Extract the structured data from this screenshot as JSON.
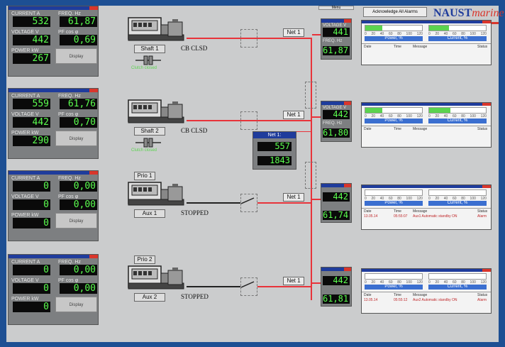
{
  "top_bar": {
    "menu_label": "Menu",
    "ack_button": "Acknowledge All Alarms",
    "brand_left": "NAUST",
    "brand_right": "marine"
  },
  "meter_panels": [
    {
      "current_label": "CURRENT A",
      "current": "532",
      "freq_label": "FREQ. Hz",
      "freq": "61,87",
      "voltage_label": "VOLTAGE V",
      "voltage": "442",
      "pf_label": "PF cos φ",
      "pf": "0,69",
      "power_label": "POWER kW",
      "power": "267",
      "display_label": "Display"
    },
    {
      "current_label": "CURRENT A",
      "current": "559",
      "freq_label": "FREQ. Hz",
      "freq": "61,76",
      "voltage_label": "VOLTAGE V",
      "voltage": "442",
      "pf_label": "PF cos φ",
      "pf": "0,70",
      "power_label": "POWER kW",
      "power": "290",
      "display_label": "Display"
    },
    {
      "current_label": "CURRENT A",
      "current": "0",
      "freq_label": "FREQ. Hz",
      "freq": "0,00",
      "voltage_label": "VOLTAGE V",
      "voltage": "0",
      "pf_label": "PF cos φ",
      "pf": "0,00",
      "power_label": "POWER kW",
      "power": "0",
      "display_label": "Display"
    },
    {
      "current_label": "CURRENT A",
      "current": "0",
      "freq_label": "FREQ. Hz",
      "freq": "0,00",
      "voltage_label": "VOLTAGE V",
      "voltage": "0",
      "pf_label": "PF cos φ",
      "pf": "0,00",
      "power_label": "POWER kW",
      "power": "0",
      "display_label": "Display"
    }
  ],
  "generators": [
    {
      "name": "Shaft 1",
      "prio": "",
      "status": "CB CLSD",
      "clutch": "Clutch closed",
      "breaker": "closed"
    },
    {
      "name": "Shaft 2",
      "prio": "",
      "status": "CB CLSD",
      "clutch": "Clutch closed",
      "breaker": "closed"
    },
    {
      "name": "Aux 1",
      "prio": "Prio 1",
      "status": "STOPPED",
      "clutch": "",
      "breaker": "open"
    },
    {
      "name": "Aux 2",
      "prio": "Prio 2",
      "status": "STOPPED",
      "clutch": "",
      "breaker": "open"
    }
  ],
  "net_labels": [
    "Net 1",
    "Net 1",
    "Net 1",
    "Net 1"
  ],
  "net_popup": {
    "title": "Net 1:",
    "value1": "557",
    "value2": "1843"
  },
  "right_meters": [
    {
      "voltage_label": "VOLTAGE V",
      "voltage": "441",
      "freq_label": "FREQ. Hz",
      "freq": "61,87"
    },
    {
      "voltage_label": "VOLTAGE V",
      "voltage": "442",
      "freq_label": "FREQ. Hz",
      "freq": "61,80"
    },
    {
      "voltage_label": "",
      "voltage": "442",
      "freq_label": "",
      "freq": "61,74"
    },
    {
      "voltage_label": "",
      "voltage": "442",
      "freq_label": "",
      "freq": "61,81"
    }
  ],
  "gauges": [
    {
      "power_title": "Power, %",
      "power_fill": 0.3,
      "current_title": "Current, %",
      "current_fill": 0.35,
      "log_header": {
        "date": "Date",
        "time": "Time",
        "message": "Message",
        "status": "Status"
      },
      "log": {
        "date": "",
        "time": "",
        "message": "",
        "status": ""
      }
    },
    {
      "power_title": "Power, %",
      "power_fill": 0.3,
      "current_title": "Current, %",
      "current_fill": 0.38,
      "log_header": {
        "date": "Date",
        "time": "Time",
        "message": "Message",
        "status": "Status"
      },
      "log": {
        "date": "",
        "time": "",
        "message": "",
        "status": ""
      }
    },
    {
      "power_title": "Power, %",
      "power_fill": 0,
      "current_title": "Current, %",
      "current_fill": 0,
      "log_header": {
        "date": "Date",
        "time": "Time",
        "message": "Message",
        "status": "Status"
      },
      "log": {
        "date": "13.05.14",
        "time": "05:55:07",
        "message": "Aux1 Automatic standby ON",
        "status": "Alarm"
      }
    },
    {
      "power_title": "Power, %",
      "power_fill": 0,
      "current_title": "Current, %",
      "current_fill": 0,
      "log_header": {
        "date": "Date",
        "time": "Time",
        "message": "Message",
        "status": "Status"
      },
      "log": {
        "date": "13.05.14",
        "time": "05:55:12",
        "message": "Aux2 Automatic standby ON",
        "status": "Alarm"
      }
    }
  ],
  "gauge_scale": [
    "0",
    "20",
    "40",
    "60",
    "80",
    "100",
    "120"
  ],
  "colors": {
    "bus": "#e8333a",
    "display_green": "#5bff4f",
    "header_blue": "#1f3c9c",
    "accent_red": "#d9362c"
  }
}
